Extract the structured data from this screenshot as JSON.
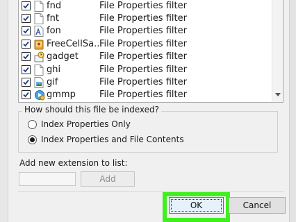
{
  "file_list": {
    "rows": [
      {
        "name": "fnd",
        "filter": "File Properties filter",
        "checked": true,
        "icon": "blank-file-icon"
      },
      {
        "name": "fnt",
        "filter": "File Properties filter",
        "checked": true,
        "icon": "blank-file-icon"
      },
      {
        "name": "fon",
        "filter": "File Properties filter",
        "checked": true,
        "icon": "font-file-icon"
      },
      {
        "name": "FreeCellSa...",
        "filter": "File Properties filter",
        "checked": true,
        "icon": "game-save-icon"
      },
      {
        "name": "gadget",
        "filter": "File Properties filter",
        "checked": true,
        "icon": "gadget-icon"
      },
      {
        "name": "ghi",
        "filter": "File Properties filter",
        "checked": true,
        "icon": "blank-file-icon"
      },
      {
        "name": "gif",
        "filter": "File Properties filter",
        "checked": true,
        "icon": "image-file-icon"
      },
      {
        "name": "gmmp",
        "filter": "File Properties filter",
        "checked": true,
        "icon": "media-file-icon"
      }
    ]
  },
  "index_options": {
    "legend": "How should this file be indexed?",
    "options": [
      {
        "label": "Index Properties Only",
        "selected": false
      },
      {
        "label": "Index Properties and File Contents",
        "selected": true
      }
    ]
  },
  "add_extension": {
    "label": "Add new extension to list:",
    "value": "",
    "button_label": "Add"
  },
  "buttons": {
    "ok_label": "OK",
    "cancel_label": "Cancel"
  },
  "colors": {
    "highlight": "#3fef20",
    "ok_border": "#3c7fb1"
  }
}
